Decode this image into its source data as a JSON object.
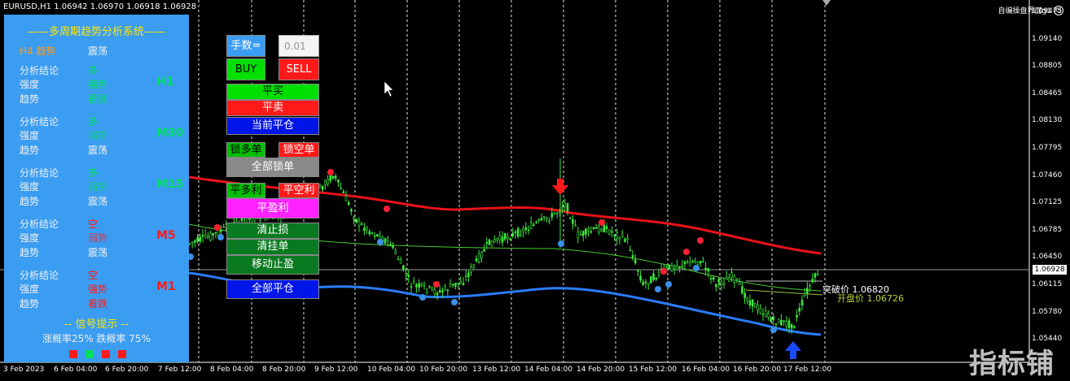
{
  "header": {
    "symbol_info": "EURUSD,H1  1.06942 1.06970 1.06918 1.06928",
    "ea_name": "自编操盘界面g1"
  },
  "price_axis": {
    "labels": [
      "1.09475",
      "1.09140",
      "1.08805",
      "1.08465",
      "1.08130",
      "1.07795",
      "1.07460",
      "1.07125",
      "1.06785",
      "1.06450",
      "1.06115",
      "1.05780",
      "1.05440"
    ],
    "current_price": "1.06928"
  },
  "time_axis": {
    "labels": [
      "3 Feb 2023",
      "6 Feb 04:00",
      "6 Feb 20:00",
      "7 Feb 12:00",
      "8 Feb 04:00",
      "8 Feb 20:00",
      "9 Feb 12:00",
      "10 Feb 04:00",
      "10 Feb 20:00",
      "13 Feb 12:00",
      "14 Feb 04:00",
      "14 Feb 20:00",
      "15 Feb 12:00",
      "16 Feb 04:00",
      "16 Feb 20:00",
      "17 Feb 12:00"
    ]
  },
  "panel": {
    "title": "——多周期趋势分析系统——",
    "h4": {
      "label": "H4 趋势",
      "value": "震荡"
    },
    "blocks": [
      {
        "tf": "H1",
        "concl_label": "分析结论",
        "concl": "多",
        "strength_label": "强度",
        "strength": "强势",
        "trend_label": "趋势",
        "trend": "看涨"
      },
      {
        "tf": "M30",
        "concl_label": "分析结论",
        "concl": "多",
        "strength_label": "强度",
        "strength": "弱势",
        "trend_label": "趋势",
        "trend": "震荡"
      },
      {
        "tf": "M15",
        "concl_label": "分析结论",
        "concl": "多",
        "strength_label": "强度",
        "strength": "弱势",
        "trend_label": "趋势",
        "trend": "震荡"
      },
      {
        "tf": "M5",
        "concl_label": "分析结论",
        "concl": "空",
        "strength_label": "强度",
        "strength": "弱势",
        "trend_label": "趋势",
        "trend": "震荡"
      },
      {
        "tf": "M1",
        "concl_label": "分析结论",
        "concl": "空",
        "strength_label": "强度",
        "strength": "强势",
        "trend_label": "趋势",
        "trend": "看跌"
      }
    ],
    "signal_title": "-- 信号提示 --",
    "signal_rate": "涨概率25% 跌概率 75%",
    "colors": {
      "bg": "#3b9df2",
      "green": "#00e060",
      "red": "#ff1a1a",
      "title": "#ffe600"
    }
  },
  "controls": {
    "lot_label": "手数=",
    "lot_value": "0.01",
    "buy": "BUY",
    "sell": "SELL",
    "close_buy": "平买",
    "close_sell": "平卖",
    "close_current": "当前平仓",
    "lock_buy": "锁多单",
    "lock_sell": "锁空单",
    "lock_all": "全部锁单",
    "close_buy_profit": "平多利",
    "close_sell_profit": "平空利",
    "close_profit": "平盈利",
    "clear_sl": "清止损",
    "clear_pending": "清挂单",
    "trailing": "移动止盈",
    "close_all": "全部平仓"
  },
  "annotations": {
    "breakout_label": "突破价",
    "breakout_value": "1.06820",
    "open_label": "开盘价",
    "open_value": "1.06726"
  },
  "watermark": "指标铺"
}
